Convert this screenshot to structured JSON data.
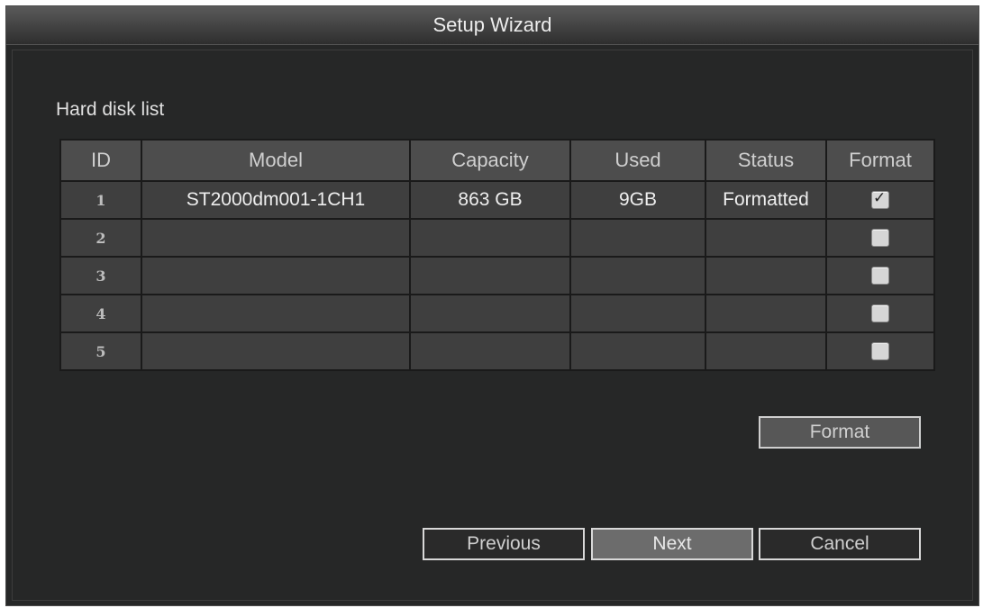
{
  "window": {
    "title": "Setup Wizard"
  },
  "section": {
    "label": "Hard disk list"
  },
  "table": {
    "headers": [
      "ID",
      "Model",
      "Capacity",
      "Used",
      "Status",
      "Format"
    ],
    "rows": [
      {
        "id": "1",
        "model": "ST2000dm001-1CH1",
        "capacity": "863  GB",
        "used": "9GB",
        "status": "Formatted",
        "checked": true
      },
      {
        "id": "2",
        "model": "",
        "capacity": "",
        "used": "",
        "status": "",
        "checked": false
      },
      {
        "id": "3",
        "model": "",
        "capacity": "",
        "used": "",
        "status": "",
        "checked": false
      },
      {
        "id": "4",
        "model": "",
        "capacity": "",
        "used": "",
        "status": "",
        "checked": false
      },
      {
        "id": "5",
        "model": "",
        "capacity": "",
        "used": "",
        "status": "",
        "checked": false
      }
    ]
  },
  "buttons": {
    "format": "Format",
    "previous": "Previous",
    "next": "Next",
    "cancel": "Cancel"
  },
  "icons": {
    "checkbox_checked": "checkbox-checked-icon",
    "checkbox_unchecked": "checkbox-unchecked-icon"
  },
  "colors": {
    "background": "#262727",
    "header_cell": "#4d4d4d",
    "row_cell": "#3f3f3f",
    "button_border": "#d8d8d8"
  }
}
